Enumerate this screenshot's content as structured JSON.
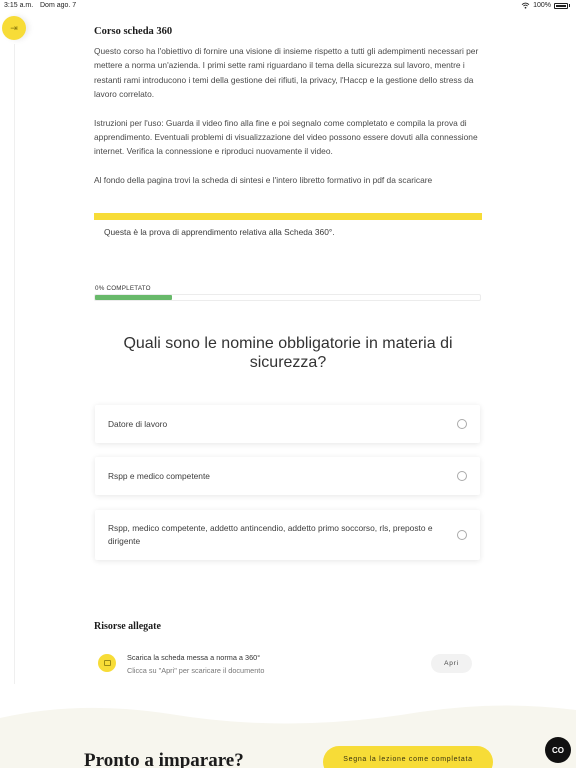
{
  "status_bar": {
    "time": "3:15 a.m.",
    "date": "Dom ago. 7",
    "battery": "100%"
  },
  "side_toggle": {
    "glyph": "⇥",
    "icon": "sidebar-toggle-icon"
  },
  "course": {
    "title": "Corso scheda 360",
    "paragraphs": [
      "Questo corso ha l'obiettivo di fornire una visione di insieme rispetto a tutti gli adempimenti necessari per mettere a norma un'azienda. I primi sette rami riguardano il tema della sicurezza sul lavoro, mentre i restanti rami introducono i temi della gestione dei rifiuti, la privacy, l'Haccp e la gestione dello stress da lavoro correlato.",
      "Istruzioni per l'uso: Guarda il video fino alla fine e poi segnalo come completato e compila la prova di apprendimento. Eventuali problemi di visualizzazione del video possono essere dovuti alla connessione internet. Verifica la connessione e riproduci nuovamente il video.",
      "Al fondo della pagina trovi la scheda di sintesi e l'intero libretto formativo in pdf da scaricare"
    ]
  },
  "quiz": {
    "note": "Questa è la prova di apprendimento relativa alla Scheda 360°.",
    "progress_label": "0% COMPLETATO",
    "progress_fraction": 0.2,
    "question": "Quali sono le nomine obbligatorie in materia di sicurezza?",
    "answers": [
      "Datore di lavoro",
      "Rspp e medico competente",
      "Rspp, medico competente, addetto antincendio, addetto primo soccorso, rls, preposto e dirigente"
    ]
  },
  "resources": {
    "title": "Risorse allegate",
    "items": [
      {
        "name": "Scarica la scheda messa a norma a 360°",
        "hint": "Clicca su \"Apri\" per scaricare il documento",
        "button": "Apri",
        "icon": "document-icon"
      }
    ]
  },
  "footer": {
    "title": "Pronto a imparare?",
    "complete_button": "Segna la lezione come completata",
    "cc_button": "CO"
  },
  "colors": {
    "accent_yellow": "#f7dc37",
    "progress_green": "#68b96a",
    "text": "#2b2b2b"
  }
}
